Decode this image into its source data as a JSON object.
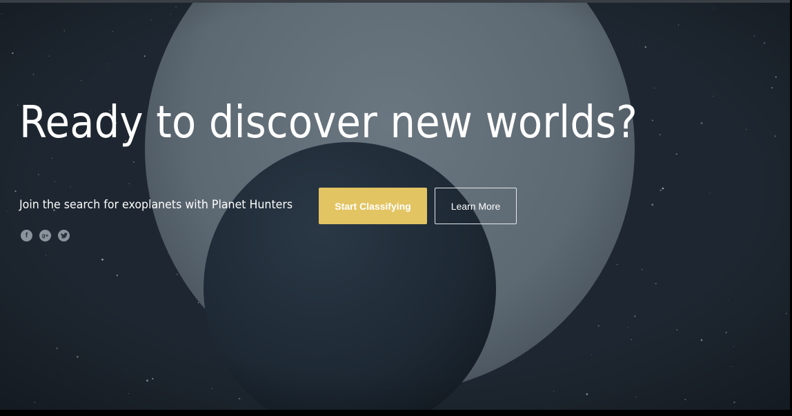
{
  "hero": {
    "headline": "Ready to discover new worlds?",
    "subtitle": "Join the search for exoplanets with Planet Hunters",
    "primary_button": "Start Classifying",
    "secondary_button": "Learn More"
  },
  "social": [
    {
      "icon": "facebook-icon",
      "glyph": "f"
    },
    {
      "icon": "google-plus-icon",
      "glyph": "g+"
    },
    {
      "icon": "twitter-icon",
      "glyph": ""
    }
  ],
  "colors": {
    "primary_button": "#e3c463",
    "background": "#1c2530",
    "moon": "#5b6770",
    "planet": "#1f2b36"
  }
}
